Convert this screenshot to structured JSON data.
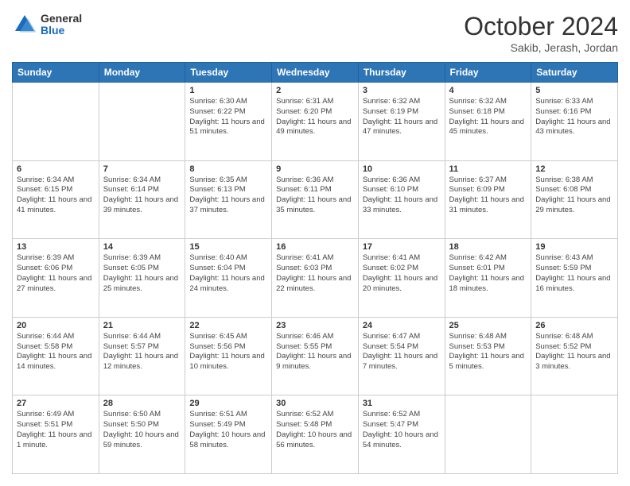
{
  "logo": {
    "general": "General",
    "blue": "Blue"
  },
  "header": {
    "month": "October 2024",
    "location": "Sakib, Jerash, Jordan"
  },
  "days": [
    "Sunday",
    "Monday",
    "Tuesday",
    "Wednesday",
    "Thursday",
    "Friday",
    "Saturday"
  ],
  "weeks": [
    [
      {
        "num": "",
        "lines": []
      },
      {
        "num": "",
        "lines": []
      },
      {
        "num": "1",
        "lines": [
          "Sunrise: 6:30 AM",
          "Sunset: 6:22 PM",
          "Daylight: 11 hours and 51 minutes."
        ]
      },
      {
        "num": "2",
        "lines": [
          "Sunrise: 6:31 AM",
          "Sunset: 6:20 PM",
          "Daylight: 11 hours and 49 minutes."
        ]
      },
      {
        "num": "3",
        "lines": [
          "Sunrise: 6:32 AM",
          "Sunset: 6:19 PM",
          "Daylight: 11 hours and 47 minutes."
        ]
      },
      {
        "num": "4",
        "lines": [
          "Sunrise: 6:32 AM",
          "Sunset: 6:18 PM",
          "Daylight: 11 hours and 45 minutes."
        ]
      },
      {
        "num": "5",
        "lines": [
          "Sunrise: 6:33 AM",
          "Sunset: 6:16 PM",
          "Daylight: 11 hours and 43 minutes."
        ]
      }
    ],
    [
      {
        "num": "6",
        "lines": [
          "Sunrise: 6:34 AM",
          "Sunset: 6:15 PM",
          "Daylight: 11 hours and 41 minutes."
        ]
      },
      {
        "num": "7",
        "lines": [
          "Sunrise: 6:34 AM",
          "Sunset: 6:14 PM",
          "Daylight: 11 hours and 39 minutes."
        ]
      },
      {
        "num": "8",
        "lines": [
          "Sunrise: 6:35 AM",
          "Sunset: 6:13 PM",
          "Daylight: 11 hours and 37 minutes."
        ]
      },
      {
        "num": "9",
        "lines": [
          "Sunrise: 6:36 AM",
          "Sunset: 6:11 PM",
          "Daylight: 11 hours and 35 minutes."
        ]
      },
      {
        "num": "10",
        "lines": [
          "Sunrise: 6:36 AM",
          "Sunset: 6:10 PM",
          "Daylight: 11 hours and 33 minutes."
        ]
      },
      {
        "num": "11",
        "lines": [
          "Sunrise: 6:37 AM",
          "Sunset: 6:09 PM",
          "Daylight: 11 hours and 31 minutes."
        ]
      },
      {
        "num": "12",
        "lines": [
          "Sunrise: 6:38 AM",
          "Sunset: 6:08 PM",
          "Daylight: 11 hours and 29 minutes."
        ]
      }
    ],
    [
      {
        "num": "13",
        "lines": [
          "Sunrise: 6:39 AM",
          "Sunset: 6:06 PM",
          "Daylight: 11 hours and 27 minutes."
        ]
      },
      {
        "num": "14",
        "lines": [
          "Sunrise: 6:39 AM",
          "Sunset: 6:05 PM",
          "Daylight: 11 hours and 25 minutes."
        ]
      },
      {
        "num": "15",
        "lines": [
          "Sunrise: 6:40 AM",
          "Sunset: 6:04 PM",
          "Daylight: 11 hours and 24 minutes."
        ]
      },
      {
        "num": "16",
        "lines": [
          "Sunrise: 6:41 AM",
          "Sunset: 6:03 PM",
          "Daylight: 11 hours and 22 minutes."
        ]
      },
      {
        "num": "17",
        "lines": [
          "Sunrise: 6:41 AM",
          "Sunset: 6:02 PM",
          "Daylight: 11 hours and 20 minutes."
        ]
      },
      {
        "num": "18",
        "lines": [
          "Sunrise: 6:42 AM",
          "Sunset: 6:01 PM",
          "Daylight: 11 hours and 18 minutes."
        ]
      },
      {
        "num": "19",
        "lines": [
          "Sunrise: 6:43 AM",
          "Sunset: 5:59 PM",
          "Daylight: 11 hours and 16 minutes."
        ]
      }
    ],
    [
      {
        "num": "20",
        "lines": [
          "Sunrise: 6:44 AM",
          "Sunset: 5:58 PM",
          "Daylight: 11 hours and 14 minutes."
        ]
      },
      {
        "num": "21",
        "lines": [
          "Sunrise: 6:44 AM",
          "Sunset: 5:57 PM",
          "Daylight: 11 hours and 12 minutes."
        ]
      },
      {
        "num": "22",
        "lines": [
          "Sunrise: 6:45 AM",
          "Sunset: 5:56 PM",
          "Daylight: 11 hours and 10 minutes."
        ]
      },
      {
        "num": "23",
        "lines": [
          "Sunrise: 6:46 AM",
          "Sunset: 5:55 PM",
          "Daylight: 11 hours and 9 minutes."
        ]
      },
      {
        "num": "24",
        "lines": [
          "Sunrise: 6:47 AM",
          "Sunset: 5:54 PM",
          "Daylight: 11 hours and 7 minutes."
        ]
      },
      {
        "num": "25",
        "lines": [
          "Sunrise: 6:48 AM",
          "Sunset: 5:53 PM",
          "Daylight: 11 hours and 5 minutes."
        ]
      },
      {
        "num": "26",
        "lines": [
          "Sunrise: 6:48 AM",
          "Sunset: 5:52 PM",
          "Daylight: 11 hours and 3 minutes."
        ]
      }
    ],
    [
      {
        "num": "27",
        "lines": [
          "Sunrise: 6:49 AM",
          "Sunset: 5:51 PM",
          "Daylight: 11 hours and 1 minute."
        ]
      },
      {
        "num": "28",
        "lines": [
          "Sunrise: 6:50 AM",
          "Sunset: 5:50 PM",
          "Daylight: 10 hours and 59 minutes."
        ]
      },
      {
        "num": "29",
        "lines": [
          "Sunrise: 6:51 AM",
          "Sunset: 5:49 PM",
          "Daylight: 10 hours and 58 minutes."
        ]
      },
      {
        "num": "30",
        "lines": [
          "Sunrise: 6:52 AM",
          "Sunset: 5:48 PM",
          "Daylight: 10 hours and 56 minutes."
        ]
      },
      {
        "num": "31",
        "lines": [
          "Sunrise: 6:52 AM",
          "Sunset: 5:47 PM",
          "Daylight: 10 hours and 54 minutes."
        ]
      },
      {
        "num": "",
        "lines": []
      },
      {
        "num": "",
        "lines": []
      }
    ]
  ]
}
